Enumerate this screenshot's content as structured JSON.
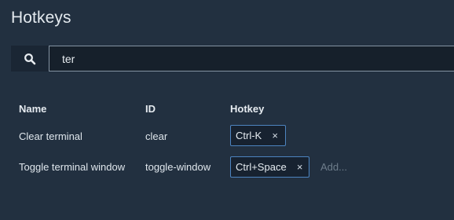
{
  "page": {
    "title": "Hotkeys"
  },
  "search": {
    "value": "ter",
    "icon": "search-icon"
  },
  "table": {
    "columns": [
      "Name",
      "ID",
      "Hotkey"
    ],
    "rows": [
      {
        "name": "Clear terminal",
        "id": "clear",
        "hotkeys": [
          "Ctrl-K"
        ]
      },
      {
        "name": "Toggle terminal window",
        "id": "toggle-window",
        "hotkeys": [
          "Ctrl+Space"
        ],
        "add_placeholder": "Add..."
      }
    ]
  },
  "chip_remove_glyph": "×",
  "colors": {
    "background": "#223040",
    "chip_border": "#4d84c0",
    "input_border": "#8494a3"
  }
}
